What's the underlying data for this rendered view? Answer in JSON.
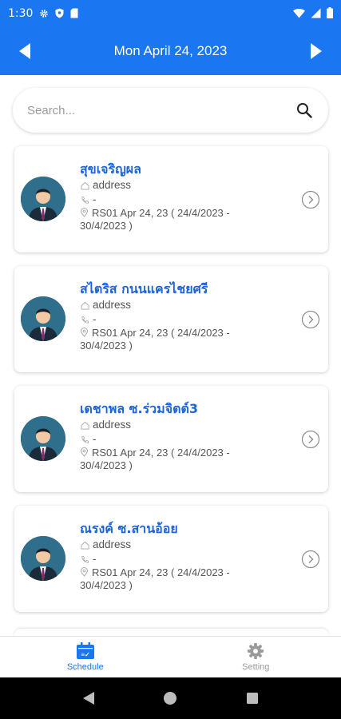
{
  "status_bar": {
    "time": "1:30",
    "left_icons": [
      "gear-icon",
      "shield-icon",
      "sd-card-icon"
    ],
    "right_icons": [
      "wifi-icon",
      "signal-icon",
      "battery-icon"
    ]
  },
  "header": {
    "title": "Mon April 24, 2023",
    "prev_icon": "caret-left-icon",
    "next_icon": "caret-right-icon",
    "color": "#1b76f1"
  },
  "search": {
    "placeholder": "Search...",
    "value": ""
  },
  "cards": [
    {
      "name": "สุขเจริญผล",
      "address": "address",
      "phone": "-",
      "detail_line1": "RS01 Apr 24, 23 ( 24/4/2023 -",
      "detail_line2": "30/4/2023 )"
    },
    {
      "name": "สไตริส กนนแครไชยศรี",
      "address": "address",
      "phone": "-",
      "detail_line1": "RS01 Apr 24, 23 ( 24/4/2023 -",
      "detail_line2": "30/4/2023 )"
    },
    {
      "name": "เดชาพล ซ.ร่วมจิตต์3",
      "address": "address",
      "phone": "-",
      "detail_line1": "RS01 Apr 24, 23 ( 24/4/2023 -",
      "detail_line2": "30/4/2023 )"
    },
    {
      "name": "ณรงค์ ซ.สานอ้อย",
      "address": "address",
      "phone": "-",
      "detail_line1": "RS01 Apr 24, 23 ( 24/4/2023 -",
      "detail_line2": "30/4/2023 )"
    }
  ],
  "bottom_nav": {
    "items": [
      {
        "label": "Schedule",
        "icon": "calendar-icon",
        "active": true
      },
      {
        "label": "Setting",
        "icon": "gear-icon",
        "active": false
      }
    ],
    "active_color": "#1b76f1"
  },
  "system_nav": [
    "back-icon",
    "home-icon",
    "recents-icon"
  ]
}
